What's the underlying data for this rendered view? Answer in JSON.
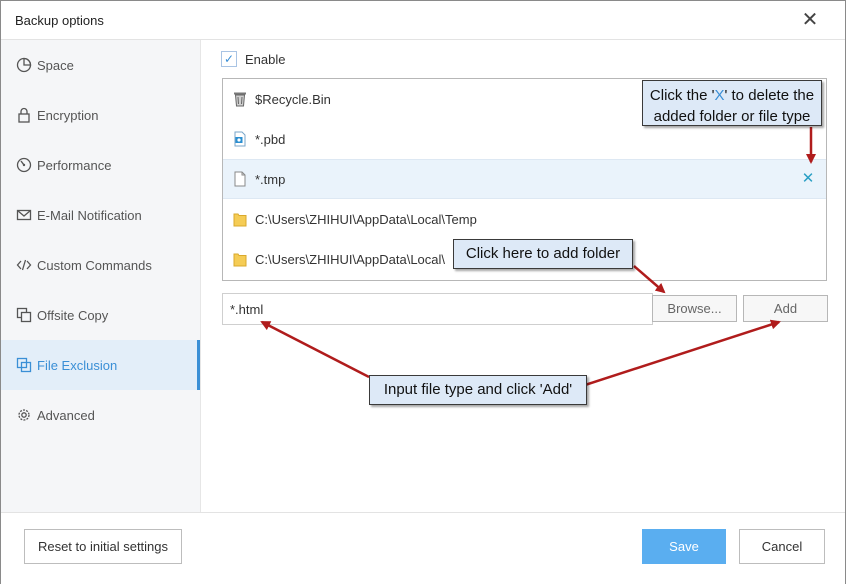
{
  "window": {
    "title": "Backup options"
  },
  "sidebar": {
    "items": [
      {
        "label": "Space",
        "icon": "pie-chart-icon",
        "active": false
      },
      {
        "label": "Encryption",
        "icon": "lock-icon",
        "active": false
      },
      {
        "label": "Performance",
        "icon": "gauge-icon",
        "active": false
      },
      {
        "label": "E-Mail Notification",
        "icon": "envelope-icon",
        "active": false
      },
      {
        "label": "Custom Commands",
        "icon": "code-icon",
        "active": false
      },
      {
        "label": "Offsite Copy",
        "icon": "copy-icon",
        "active": false
      },
      {
        "label": "File Exclusion",
        "icon": "file-exclusion-icon",
        "active": true
      },
      {
        "label": "Advanced",
        "icon": "gear-icon",
        "active": false
      }
    ]
  },
  "exclusion": {
    "enable_label": "Enable",
    "enabled": true,
    "items": [
      {
        "text": "$Recycle.Bin",
        "icon": "recycle-bin-icon"
      },
      {
        "text": "*.pbd",
        "icon": "pbd-file-icon"
      },
      {
        "text": "*.tmp",
        "icon": "file-icon",
        "selected": true,
        "delete_label": "✕"
      },
      {
        "text": "C:\\Users\\ZHIHUI\\AppData\\Local\\Temp",
        "icon": "folder-icon"
      },
      {
        "text": "C:\\Users\\ZHIHUI\\AppData\\Local\\",
        "icon": "folder-icon"
      }
    ],
    "input_value": "*.html",
    "browse_label": "Browse...",
    "add_label": "Add"
  },
  "footer": {
    "reset_label": "Reset to initial settings",
    "save_label": "Save",
    "cancel_label": "Cancel"
  },
  "callouts": {
    "delete_prefix": "Click the '",
    "delete_x": "X",
    "delete_suffix": "' to delete the",
    "delete_line2": "added folder or file type",
    "add_folder": "Click here to add folder",
    "input_type": "Input file type and click 'Add'"
  },
  "colors": {
    "accent": "#3a8fd6",
    "save_button": "#5aaef0",
    "callout_bg": "#dde9f7",
    "arrow": "#b01c1c"
  }
}
